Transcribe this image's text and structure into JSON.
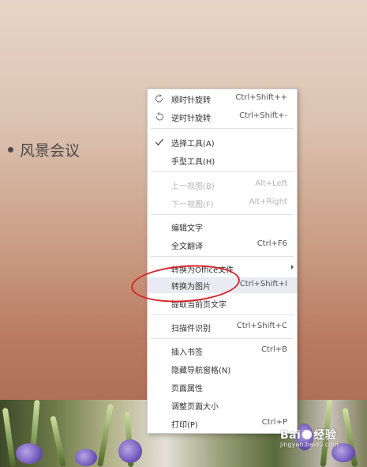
{
  "slide": {
    "bullet_text": "风景会议"
  },
  "context_menu": {
    "items": [
      {
        "label": "顺时针旋转",
        "shortcut": "Ctrl+Shift++",
        "icon": "rotate-clockwise-icon",
        "disabled": false
      },
      {
        "label": "逆时针旋转",
        "shortcut": "Ctrl+Shift+-",
        "icon": "rotate-counterclockwise-icon",
        "disabled": false
      },
      {
        "label": "选择工具(A)",
        "shortcut": "",
        "icon": "checkmark-icon",
        "disabled": false
      },
      {
        "label": "手型工具(H)",
        "shortcut": "",
        "disabled": false
      },
      {
        "label": "上一视图(B)",
        "shortcut": "Alt+Left",
        "disabled": true
      },
      {
        "label": "下一视图(F)",
        "shortcut": "Alt+Right",
        "disabled": true
      },
      {
        "label": "编辑文字",
        "shortcut": "",
        "disabled": false
      },
      {
        "label": "全文翻译",
        "shortcut": "Ctrl+F6",
        "disabled": false
      },
      {
        "label": "转换为Office文件",
        "shortcut": "",
        "submenu": true,
        "disabled": false
      },
      {
        "label": "转换为图片",
        "shortcut": "Ctrl+Shift+I",
        "highlighted": true,
        "disabled": false
      },
      {
        "label": "提取当前页文字",
        "shortcut": "",
        "disabled": false
      },
      {
        "label": "扫描件识别",
        "shortcut": "Ctrl+Shift+C",
        "disabled": false
      },
      {
        "label": "插入书签",
        "shortcut": "Ctrl+B",
        "disabled": false
      },
      {
        "label": "隐藏导航窗格(N)",
        "shortcut": "",
        "disabled": false
      },
      {
        "label": "页面属性",
        "shortcut": "",
        "disabled": false
      },
      {
        "label": "调整页面大小",
        "shortcut": "",
        "disabled": false
      },
      {
        "label": "打印(P)",
        "shortcut": "Ctrl+P",
        "disabled": false
      }
    ]
  },
  "annotation": {
    "highlight_color": "#d8252a"
  },
  "watermark": {
    "brand_left": "Bai",
    "brand_right": "经验",
    "url": "jingyan.baidu.com"
  },
  "colors": {
    "menu_bg": "#ffffff",
    "menu_border": "#c8c8c8",
    "disabled_text": "#b5b5b5",
    "highlight_row": "#e8ecf2"
  }
}
